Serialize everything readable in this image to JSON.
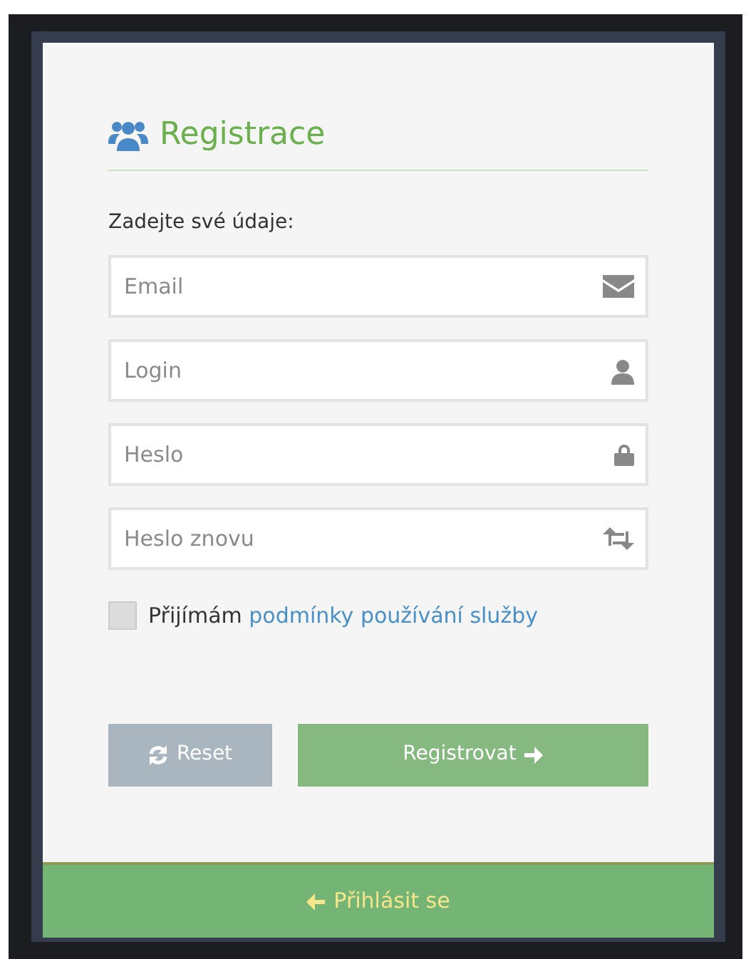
{
  "title": "Registrace",
  "prompt": "Zadejte své údaje:",
  "fields": [
    {
      "placeholder": "Email"
    },
    {
      "placeholder": "Login"
    },
    {
      "placeholder": "Heslo"
    },
    {
      "placeholder": "Heslo znovu"
    }
  ],
  "terms": {
    "checked": false,
    "label": "Přijímám",
    "link": "podmínky používání služby"
  },
  "buttons": [
    {
      "label": "Reset",
      "kind": "reset"
    },
    {
      "label": "Registrovat",
      "kind": "submit"
    }
  ],
  "footer_link": "Přihlásit se"
}
